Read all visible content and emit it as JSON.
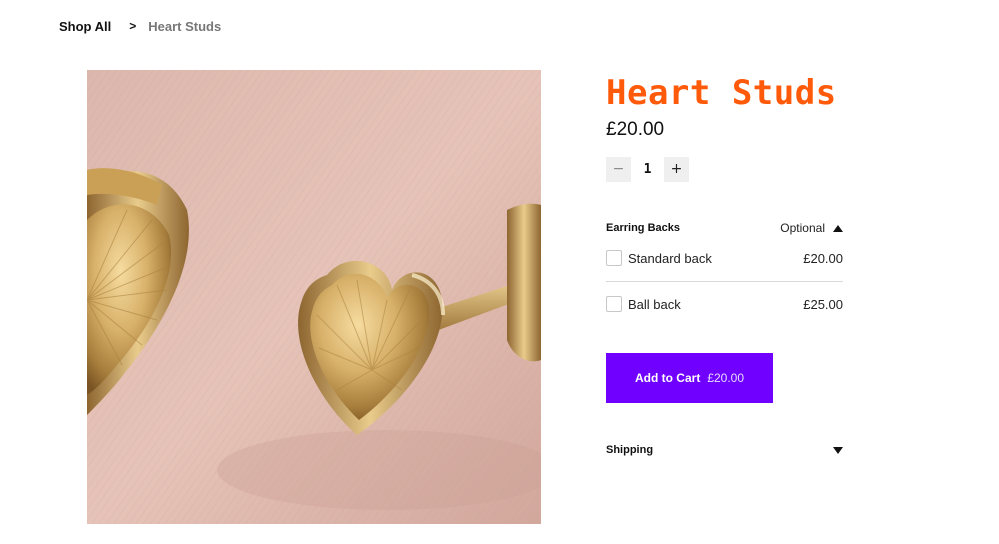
{
  "breadcrumb": {
    "root": "Shop All",
    "separator": ">",
    "current": "Heart Studs"
  },
  "product": {
    "title": "Heart Studs",
    "price": "£20.00",
    "title_color": "#ff5a0a",
    "image_alt_icon": "heart-stud-earrings-photo"
  },
  "quantity": {
    "decrement": "−",
    "value": "1",
    "increment": "+"
  },
  "earring_backs": {
    "title": "Earring Backs",
    "status": "Optional",
    "options": [
      {
        "label": "Standard back",
        "price": "£20.00",
        "checked": false
      },
      {
        "label": "Ball back",
        "price": "£25.00",
        "checked": false
      }
    ]
  },
  "cart": {
    "label": "Add to Cart",
    "price": "£20.00",
    "color": "#7000ff"
  },
  "shipping": {
    "label": "Shipping"
  }
}
